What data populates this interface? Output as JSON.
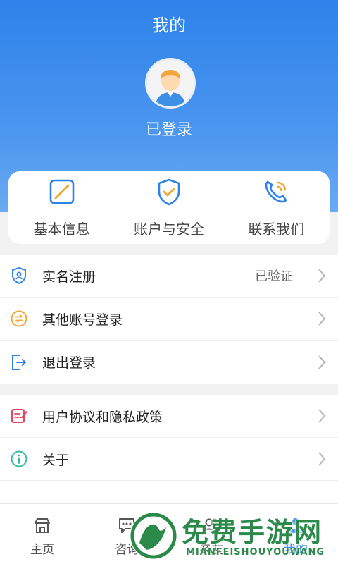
{
  "header": {
    "title": "我的",
    "status": "已登录",
    "avatar_icon": "user-avatar-icon",
    "gradient_top": "#2e82ea",
    "gradient_bottom": "#6aaaf3"
  },
  "quick_actions": [
    {
      "label": "基本信息",
      "icon": "edit-square-icon"
    },
    {
      "label": "账户与安全",
      "icon": "shield-check-icon"
    },
    {
      "label": "联系我们",
      "icon": "phone-icon"
    }
  ],
  "menu_group_1": [
    {
      "label": "实名注册",
      "value": "已验证",
      "icon": "id-shield-icon"
    },
    {
      "label": "其他账号登录",
      "icon": "switch-account-icon"
    },
    {
      "label": "退出登录",
      "icon": "logout-icon"
    }
  ],
  "menu_group_2": [
    {
      "label": "用户协议和隐私政策",
      "icon": "agreement-icon"
    },
    {
      "label": "关于",
      "icon": "info-icon"
    }
  ],
  "bottom_nav": [
    {
      "label": "主页",
      "icon": "home-icon"
    },
    {
      "label": "咨询",
      "icon": "chat-icon"
    },
    {
      "label": "亲友",
      "icon": "friends-icon"
    },
    {
      "label": "我的",
      "icon": "profile-icon",
      "active": true
    }
  ],
  "watermark": {
    "title": "免费手游网",
    "subtitle": "MIANFEISHOUYOUWANG"
  },
  "colors": {
    "accent": "#2e82ea",
    "watermark": "#2b8a4a"
  }
}
